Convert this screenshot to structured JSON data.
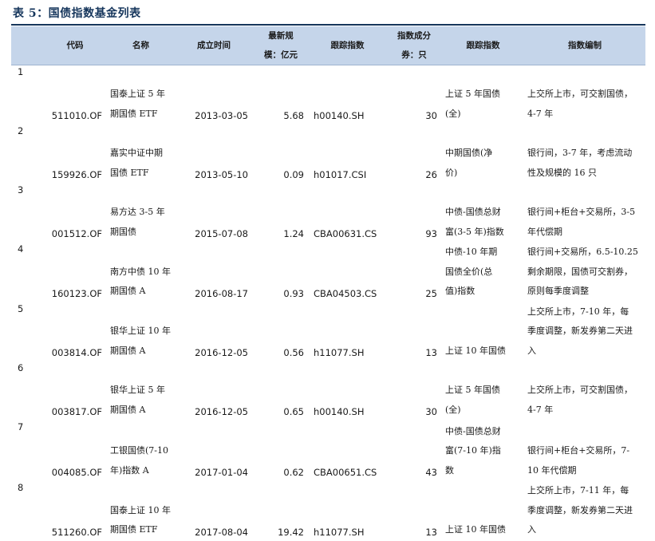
{
  "title": "表 5：国债指数基金列表",
  "headers": [
    "",
    "代码",
    "名称",
    "成立时间",
    "最新规模：亿元",
    "跟踪指数",
    "指数成分券：只",
    "跟踪指数",
    "指数编制"
  ],
  "headers_display": {
    "code": "代码",
    "name": "名称",
    "date": "成立时间",
    "scale_line1": "最新规",
    "scale_line2": "模：亿元",
    "track_code": "跟踪指数",
    "components_line1": "指数成分",
    "components_line2": "券：只",
    "track_name": "跟踪指数",
    "method": "指数编制"
  },
  "rows": [
    {
      "no": "1",
      "code": "511010.OF",
      "name": "国泰上证 5 年\n期国债 ETF",
      "date": "2013-03-05",
      "scale": "5.68",
      "index_code": "h00140.SH",
      "components": "30",
      "index_name": "上证 5 年国债\n(全)",
      "method": "上交所上市，可交割国债，\n4-7 年"
    },
    {
      "no": "2",
      "code": "159926.OF",
      "name": "嘉实中证中期\n国债 ETF",
      "date": "2013-05-10",
      "scale": "0.09",
      "index_code": "h01017.CSI",
      "components": "26",
      "index_name": "中期国债(净\n价)",
      "method": "银行间，3-7 年，考虑流动\n性及规模的 16 只"
    },
    {
      "no": "3",
      "code": "001512.OF",
      "name": "易方达 3-5 年\n期国债",
      "date": "2015-07-08",
      "scale": "1.24",
      "index_code": "CBA00631.CS",
      "components": "93",
      "index_name": "中债-国债总财\n富(3-5 年)指数",
      "method": "银行间+柜台+交易所，3-5\n年代偿期"
    },
    {
      "no": "4",
      "code": "160123.OF",
      "name": "南方中债 10 年\n期国债 A",
      "date": "2016-08-17",
      "scale": "0.93",
      "index_code": "CBA04503.CS",
      "components": "25",
      "index_name": "中债-10 年期\n国债全价(总\n值)指数",
      "method": "银行间+交易所，6.5-10.25\n剩余期限，国债可交割券，\n原则每季度调整"
    },
    {
      "no": "5",
      "code": "003814.OF",
      "name": "银华上证 10 年\n期国债 A",
      "date": "2016-12-05",
      "scale": "0.56",
      "index_code": "h11077.SH",
      "components": "13",
      "index_name": "上证 10 年国债",
      "method": "上交所上市，7-10 年，每\n季度调整，新发券第二天进\n入"
    },
    {
      "no": "6",
      "code": "003817.OF",
      "name": "银华上证 5 年\n期国债 A",
      "date": "2016-12-05",
      "scale": "0.65",
      "index_code": "h00140.SH",
      "components": "30",
      "index_name": "上证 5 年国债\n(全)",
      "method": "上交所上市，可交割国债，\n4-7 年"
    },
    {
      "no": "7",
      "code": "004085.OF",
      "name": "工银国债(7-10\n年)指数 A",
      "date": "2017-01-04",
      "scale": "0.62",
      "index_code": "CBA00651.CS",
      "components": "43",
      "index_name": "中债-国债总财\n富(7-10 年)指\n数",
      "method": "银行间+柜台+交易所，7-\n10 年代偿期"
    },
    {
      "no": "8",
      "code": "511260.OF",
      "name": "国泰上证 10 年\n期国债 ETF",
      "date": "2017-08-04",
      "scale": "19.42",
      "index_code": "h11077.SH",
      "components": "13",
      "index_name": "上证 10 年国债",
      "method": "上交所上市，7-11 年，每\n季度调整，新发券第二天进\n入"
    }
  ]
}
